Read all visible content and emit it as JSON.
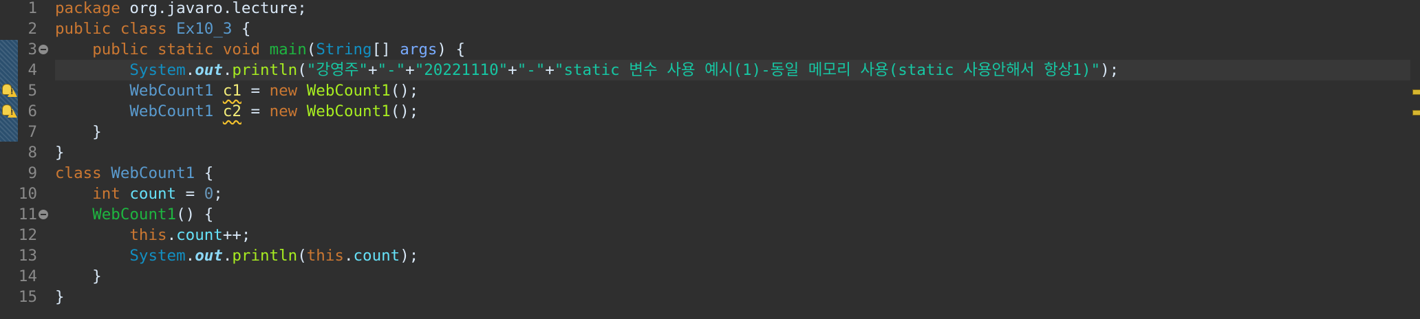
{
  "editor": {
    "language": "java",
    "lines": [
      {
        "n": "1",
        "tokens": [
          {
            "t": "package",
            "c": "kw"
          },
          {
            "t": " org.javaro.lecture;",
            "c": "plain"
          }
        ]
      },
      {
        "n": "2",
        "tokens": [
          {
            "t": "public",
            "c": "kw"
          },
          {
            "t": " ",
            "c": "plain"
          },
          {
            "t": "class",
            "c": "kw"
          },
          {
            "t": " ",
            "c": "plain"
          },
          {
            "t": "Ex10_3",
            "c": "cls"
          },
          {
            "t": " {",
            "c": "plain"
          }
        ]
      },
      {
        "n": "3",
        "fold": true,
        "tokens": [
          {
            "t": "    ",
            "c": "plain"
          },
          {
            "t": "public",
            "c": "kw"
          },
          {
            "t": " ",
            "c": "plain"
          },
          {
            "t": "static",
            "c": "kw"
          },
          {
            "t": " ",
            "c": "plain"
          },
          {
            "t": "void",
            "c": "kw"
          },
          {
            "t": " ",
            "c": "plain"
          },
          {
            "t": "main",
            "c": "method-decl"
          },
          {
            "t": "(",
            "c": "plain"
          },
          {
            "t": "String",
            "c": "type"
          },
          {
            "t": "[] ",
            "c": "plain"
          },
          {
            "t": "args",
            "c": "param"
          },
          {
            "t": ") {",
            "c": "plain"
          }
        ]
      },
      {
        "n": "4",
        "current": true,
        "tokens": [
          {
            "t": "        ",
            "c": "plain"
          },
          {
            "t": "System",
            "c": "type"
          },
          {
            "t": ".",
            "c": "plain"
          },
          {
            "t": "out",
            "c": "static-field"
          },
          {
            "t": ".",
            "c": "plain"
          },
          {
            "t": "println",
            "c": "method-call"
          },
          {
            "t": "(",
            "c": "plain"
          },
          {
            "t": "\"강영주\"",
            "c": "str"
          },
          {
            "t": "+",
            "c": "plain"
          },
          {
            "t": "\"-\"",
            "c": "str"
          },
          {
            "t": "+",
            "c": "plain"
          },
          {
            "t": "\"20221110\"",
            "c": "str"
          },
          {
            "t": "+",
            "c": "plain"
          },
          {
            "t": "\"-\"",
            "c": "str"
          },
          {
            "t": "+",
            "c": "plain"
          },
          {
            "t": "\"static 변수 사용 예시(1)-동일 메모리 사용(static 사용안해서 항상1)\"",
            "c": "str"
          },
          {
            "t": ");",
            "c": "plain"
          }
        ]
      },
      {
        "n": "5",
        "warning": true,
        "tokens": [
          {
            "t": "        ",
            "c": "plain"
          },
          {
            "t": "WebCount1",
            "c": "cls"
          },
          {
            "t": " ",
            "c": "plain"
          },
          {
            "t": "c1",
            "c": "localvar",
            "warn": true
          },
          {
            "t": " = ",
            "c": "plain"
          },
          {
            "t": "new",
            "c": "kw"
          },
          {
            "t": " ",
            "c": "plain"
          },
          {
            "t": "WebCount1",
            "c": "method-call"
          },
          {
            "t": "();",
            "c": "plain"
          }
        ]
      },
      {
        "n": "6",
        "warning": true,
        "tokens": [
          {
            "t": "        ",
            "c": "plain"
          },
          {
            "t": "WebCount1",
            "c": "cls"
          },
          {
            "t": " ",
            "c": "plain"
          },
          {
            "t": "c2",
            "c": "localvar",
            "warn": true
          },
          {
            "t": " = ",
            "c": "plain"
          },
          {
            "t": "new",
            "c": "kw"
          },
          {
            "t": " ",
            "c": "plain"
          },
          {
            "t": "WebCount1",
            "c": "method-call"
          },
          {
            "t": "();",
            "c": "plain"
          }
        ]
      },
      {
        "n": "7",
        "tokens": [
          {
            "t": "    }",
            "c": "plain"
          }
        ]
      },
      {
        "n": "8",
        "tokens": [
          {
            "t": "}",
            "c": "plain"
          }
        ]
      },
      {
        "n": "9",
        "tokens": [
          {
            "t": "class",
            "c": "kw"
          },
          {
            "t": " ",
            "c": "plain"
          },
          {
            "t": "WebCount1",
            "c": "cls"
          },
          {
            "t": " {",
            "c": "plain"
          }
        ]
      },
      {
        "n": "10",
        "tokens": [
          {
            "t": "    ",
            "c": "plain"
          },
          {
            "t": "int",
            "c": "kw"
          },
          {
            "t": " ",
            "c": "plain"
          },
          {
            "t": "count",
            "c": "field"
          },
          {
            "t": " = ",
            "c": "plain"
          },
          {
            "t": "0",
            "c": "num"
          },
          {
            "t": ";",
            "c": "plain"
          }
        ]
      },
      {
        "n": "11",
        "fold": true,
        "tokens": [
          {
            "t": "    ",
            "c": "plain"
          },
          {
            "t": "WebCount1",
            "c": "method-decl"
          },
          {
            "t": "() {",
            "c": "plain"
          }
        ]
      },
      {
        "n": "12",
        "tokens": [
          {
            "t": "        ",
            "c": "plain"
          },
          {
            "t": "this",
            "c": "kw"
          },
          {
            "t": ".",
            "c": "plain"
          },
          {
            "t": "count",
            "c": "field"
          },
          {
            "t": "++;",
            "c": "plain"
          }
        ]
      },
      {
        "n": "13",
        "tokens": [
          {
            "t": "        ",
            "c": "plain"
          },
          {
            "t": "System",
            "c": "type"
          },
          {
            "t": ".",
            "c": "plain"
          },
          {
            "t": "out",
            "c": "static-field"
          },
          {
            "t": ".",
            "c": "plain"
          },
          {
            "t": "println",
            "c": "method-call"
          },
          {
            "t": "(",
            "c": "plain"
          },
          {
            "t": "this",
            "c": "kw"
          },
          {
            "t": ".",
            "c": "plain"
          },
          {
            "t": "count",
            "c": "field"
          },
          {
            "t": ");",
            "c": "plain"
          }
        ]
      },
      {
        "n": "14",
        "tokens": [
          {
            "t": "    }",
            "c": "plain"
          }
        ]
      },
      {
        "n": "15",
        "tokens": [
          {
            "t": "}",
            "c": "plain"
          }
        ]
      }
    ]
  },
  "ruler_markers": [
    {
      "line": "5",
      "icon": "quick-fix-warning-icon"
    },
    {
      "line": "6",
      "icon": "quick-fix-warning-icon"
    }
  ],
  "overview_markers": [
    {
      "line": "5",
      "icon": "warning-marker-icon"
    },
    {
      "line": "6",
      "icon": "warning-marker-icon"
    }
  ],
  "colors": {
    "background": "#2f2f2f",
    "keyword": "#cc7832",
    "string": "#17c6a3",
    "line_number": "#8a8a8a",
    "current_line": "#383838",
    "warning": "#f2c12e"
  }
}
